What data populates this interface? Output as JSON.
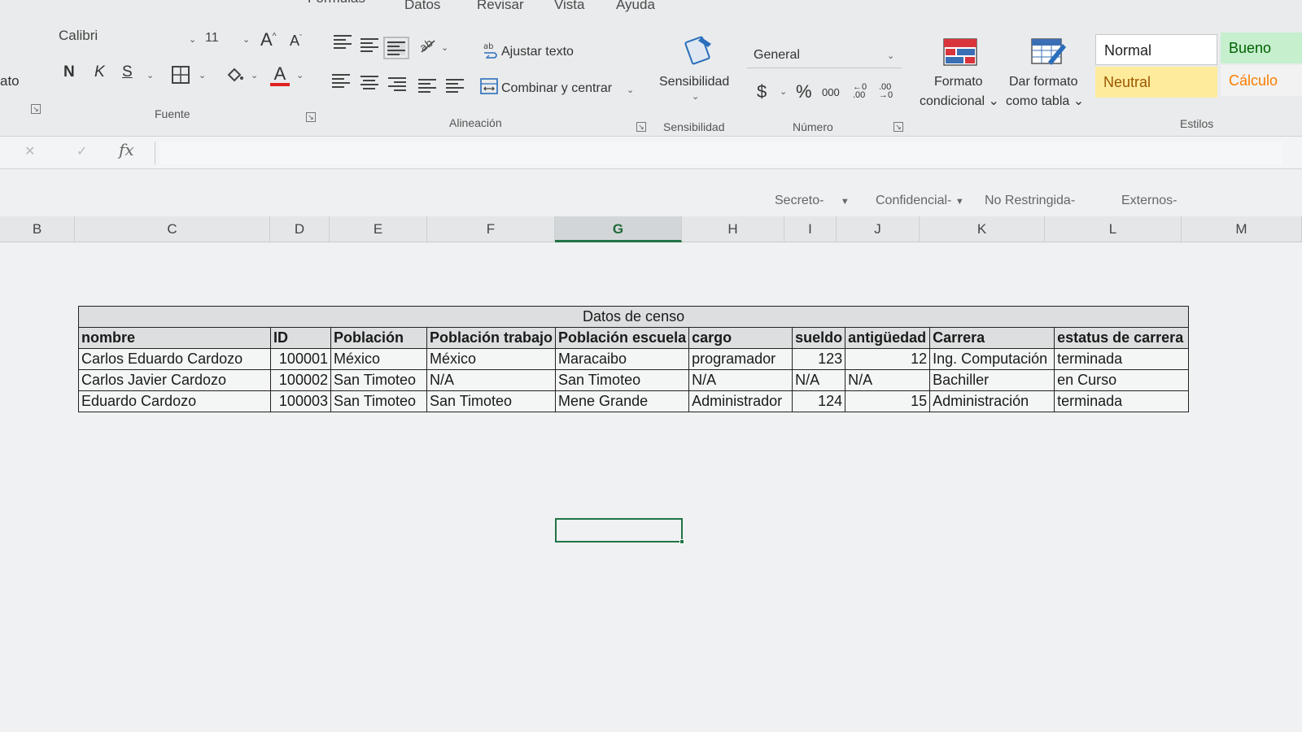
{
  "menu_tabs": [
    "Fórmulas",
    "Datos",
    "Revisar",
    "Vista",
    "Ayuda"
  ],
  "font": {
    "family": "Calibri",
    "size": "11",
    "grow": "A",
    "shrink": "A",
    "bold": "N",
    "italic": "K",
    "underline": "S",
    "font_color": "A",
    "group_label": "Fuente"
  },
  "left_edge_label": "ato",
  "alignment": {
    "wrap_text": "Ajustar texto",
    "merge_center": "Combinar y centrar",
    "group_label": "Alineación"
  },
  "sensitivity": {
    "button": "Sensibilidad",
    "group_label": "Sensibilidad"
  },
  "number": {
    "format": "General",
    "currency": "$",
    "percent": "%",
    "thousands": "000",
    "increase_decimals": "←0 .00",
    "decrease_decimals": ".00 →0",
    "group_label": "Número"
  },
  "styles_group": {
    "conditional_format": [
      "Formato",
      "condicional"
    ],
    "format_as_table": [
      "Dar formato",
      "como tabla"
    ],
    "group_label": "Estilos",
    "cells": [
      {
        "label": "Normal",
        "bg": "#ffffff",
        "color": "#222222"
      },
      {
        "label": "Bueno",
        "bg": "#c6efce",
        "color": "#006100"
      },
      {
        "label": "Neutral",
        "bg": "#ffeb9c",
        "color": "#9c5700"
      },
      {
        "label": "Cálculo",
        "bg": "#f2f2f2",
        "color": "#fa7d00"
      }
    ]
  },
  "formula_bar": {
    "fx": "fx",
    "cancel": "✕",
    "enter": "✓",
    "value": ""
  },
  "sensitivity_labels": [
    "Secreto-",
    "Confidencial-",
    "No Restringida-",
    "Externos-"
  ],
  "columns": [
    "B",
    "C",
    "D",
    "E",
    "F",
    "G",
    "H",
    "I",
    "J",
    "K",
    "L",
    "M"
  ],
  "selected_column": "G",
  "table": {
    "title": "Datos de censo",
    "headers": [
      "nombre",
      "ID",
      "Población",
      "Población trabajo",
      "Población escuela",
      "cargo",
      "sueldo",
      "antigüedad",
      "Carrera",
      "estatus de carrera"
    ],
    "rows": [
      [
        "Carlos Eduardo Cardozo",
        "100001",
        "México",
        "México",
        "Maracaibo",
        "programador",
        "123",
        "12",
        "Ing. Computación",
        "terminada"
      ],
      [
        "Carlos Javier Cardozo",
        "100002",
        "San Timoteo",
        "N/A",
        "San Timoteo",
        "N/A",
        "N/A",
        "N/A",
        "Bachiller",
        "en Curso"
      ],
      [
        "Eduardo Cardozo",
        "100003",
        "San Timoteo",
        "San Timoteo",
        "Mene Grande",
        "Administrador",
        "124",
        "15",
        "Administración",
        "terminada"
      ]
    ]
  },
  "accent_color": "#217346"
}
